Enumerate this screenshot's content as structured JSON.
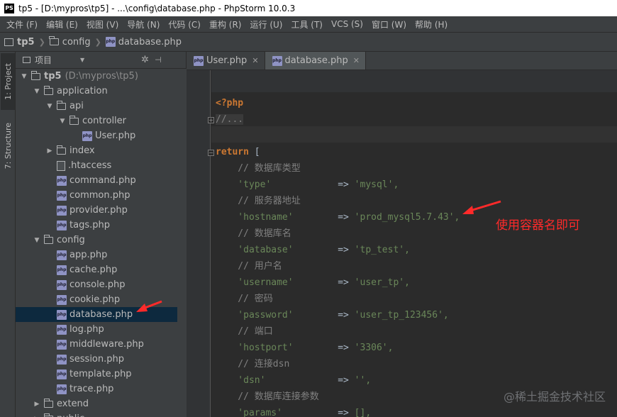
{
  "window": {
    "title": "tp5 - [D:\\mypros\\tp5] - ...\\config\\database.php - PhpStorm 10.0.3",
    "logo": "PS"
  },
  "menu": [
    "文件 (F)",
    "编辑 (E)",
    "视图 (V)",
    "导航 (N)",
    "代码 (C)",
    "重构 (R)",
    "运行 (U)",
    "工具 (T)",
    "VCS (S)",
    "窗口 (W)",
    "帮助 (H)"
  ],
  "breadcrumb": [
    "tp5",
    "config",
    "database.php"
  ],
  "toolwindows": {
    "project": "1: Project",
    "structure": "7: Structure"
  },
  "project_panel": {
    "title": "项目"
  },
  "tree": [
    {
      "label": "tp5",
      "extra": "(D:\\mypros\\tp5)",
      "depth": 0,
      "type": "folder",
      "expanded": true
    },
    {
      "label": "application",
      "depth": 1,
      "type": "folder",
      "expanded": true
    },
    {
      "label": "api",
      "depth": 2,
      "type": "folder",
      "expanded": true
    },
    {
      "label": "controller",
      "depth": 3,
      "type": "folder",
      "expanded": true
    },
    {
      "label": "User.php",
      "depth": 4,
      "type": "php"
    },
    {
      "label": "index",
      "depth": 2,
      "type": "folder",
      "expanded": false
    },
    {
      "label": ".htaccess",
      "depth": 2,
      "type": "file"
    },
    {
      "label": "command.php",
      "depth": 2,
      "type": "php"
    },
    {
      "label": "common.php",
      "depth": 2,
      "type": "php"
    },
    {
      "label": "provider.php",
      "depth": 2,
      "type": "php"
    },
    {
      "label": "tags.php",
      "depth": 2,
      "type": "php"
    },
    {
      "label": "config",
      "depth": 1,
      "type": "folder",
      "expanded": true
    },
    {
      "label": "app.php",
      "depth": 2,
      "type": "php"
    },
    {
      "label": "cache.php",
      "depth": 2,
      "type": "php"
    },
    {
      "label": "console.php",
      "depth": 2,
      "type": "php"
    },
    {
      "label": "cookie.php",
      "depth": 2,
      "type": "php"
    },
    {
      "label": "database.php",
      "depth": 2,
      "type": "php",
      "selected": true
    },
    {
      "label": "log.php",
      "depth": 2,
      "type": "php"
    },
    {
      "label": "middleware.php",
      "depth": 2,
      "type": "php"
    },
    {
      "label": "session.php",
      "depth": 2,
      "type": "php"
    },
    {
      "label": "template.php",
      "depth": 2,
      "type": "php"
    },
    {
      "label": "trace.php",
      "depth": 2,
      "type": "php"
    },
    {
      "label": "extend",
      "depth": 1,
      "type": "folder",
      "expanded": false
    },
    {
      "label": "public",
      "depth": 1,
      "type": "folder",
      "expanded": false
    }
  ],
  "tabs": [
    {
      "label": "User.php",
      "active": false
    },
    {
      "label": "database.php",
      "active": true
    }
  ],
  "code": {
    "open_tag": "<?php",
    "folded": "//...",
    "return_kw": "return",
    "open_bracket": " [",
    "entries": [
      {
        "comment": "// 数据库类型",
        "key": "'type'",
        "arrow": "=>",
        "value": "'mysql',"
      },
      {
        "comment": "// 服务器地址",
        "key": "'hostname'",
        "arrow": "=>",
        "value": "'prod_mysql5.7.43',"
      },
      {
        "comment": "// 数据库名",
        "key": "'database'",
        "arrow": "=>",
        "value": "'tp_test',"
      },
      {
        "comment": "// 用户名",
        "key": "'username'",
        "arrow": "=>",
        "value": "'user_tp',"
      },
      {
        "comment": "// 密码",
        "key": "'password'",
        "arrow": "=>",
        "value": "'user_tp_123456',"
      },
      {
        "comment": "// 端口",
        "key": "'hostport'",
        "arrow": "=>",
        "value": "'3306',"
      },
      {
        "comment": "// 连接dsn",
        "key": "'dsn'",
        "arrow": "=>",
        "value": "'',"
      },
      {
        "comment": "// 数据库连接参数",
        "key": "'params'",
        "arrow": "=>",
        "value": "[],"
      }
    ]
  },
  "annotation": "使用容器名即可",
  "watermark": "@稀土掘金技术社区",
  "colors": {
    "annotation": "#ff2a2a",
    "selection": "#0d293e",
    "editor_bg": "#2b2b2b"
  }
}
